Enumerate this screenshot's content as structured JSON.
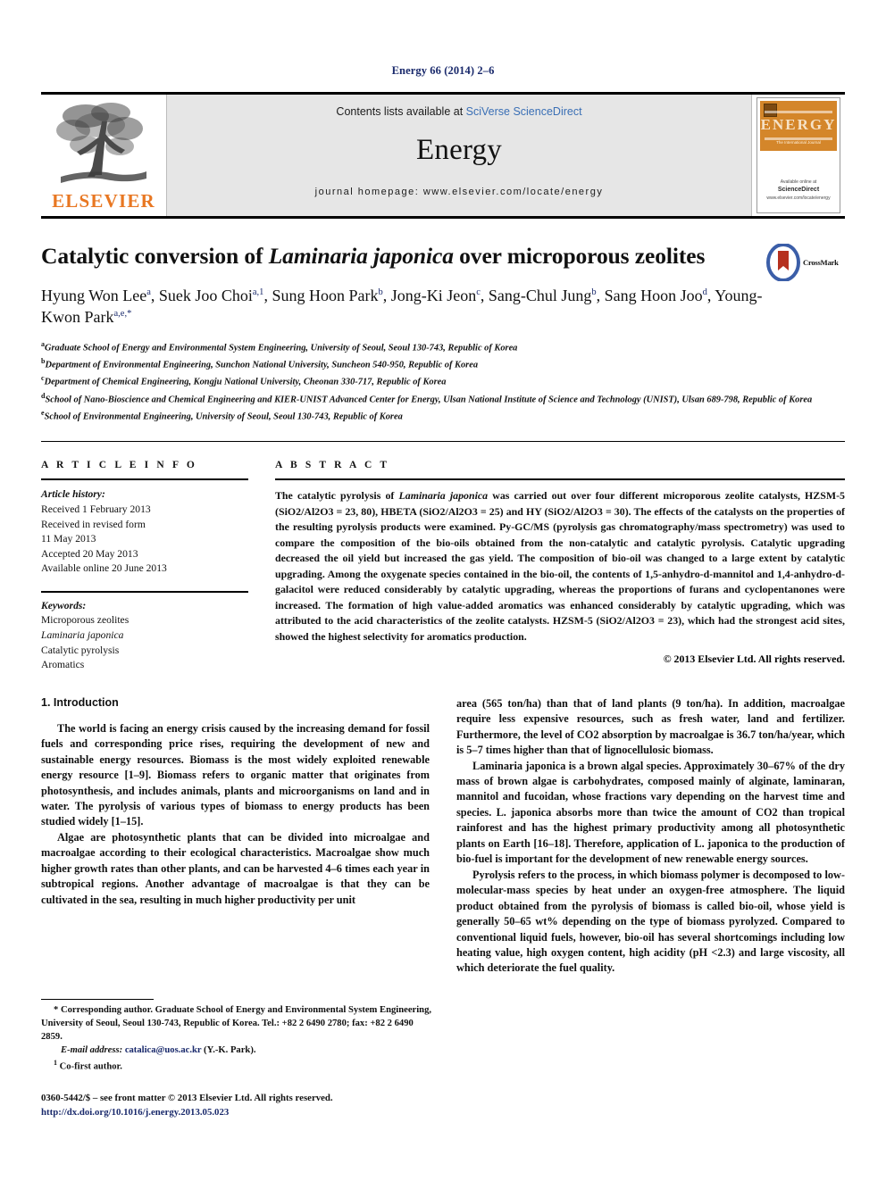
{
  "running_head": "Energy 66 (2014) 2–6",
  "masthead": {
    "publisher_wordmark": "ELSEVIER",
    "contents_prefix": "Contents lists available at ",
    "contents_link": "SciVerse ScienceDirect",
    "journal_name": "Energy",
    "homepage": "journal homepage: www.elsevier.com/locate/energy",
    "cover": {
      "banner_title": "ENERGY",
      "banner_subtitle": "The International Journal",
      "footer_line1": "Available online at",
      "footer_line2": "ScienceDirect",
      "footer_line3": "www.elsevier.com/locate/energy"
    }
  },
  "article": {
    "title_part1": "Catalytic conversion of ",
    "title_italic": "Laminaria japonica",
    "title_part2": " over microporous zeolites",
    "crossmark_label": "CrossMark",
    "authors_line1": "Hyung Won Lee a, Suek Joo Choi a,1, Sung Hoon Park b, Jong-Ki Jeon c, Sang-Chul Jung b,",
    "authors": [
      {
        "name": "Hyung Won Lee",
        "sup": "a"
      },
      {
        "name": "Suek Joo Choi",
        "sup": "a,1"
      },
      {
        "name": "Sung Hoon Park",
        "sup": "b"
      },
      {
        "name": "Jong-Ki Jeon",
        "sup": "c"
      },
      {
        "name": "Sang-Chul Jung",
        "sup": "b"
      },
      {
        "name": "Sang Hoon Joo",
        "sup": "d"
      },
      {
        "name": "Young-Kwon Park",
        "sup": "a,e,*"
      }
    ],
    "affiliations": [
      {
        "sup": "a",
        "text": "Graduate School of Energy and Environmental System Engineering, University of Seoul, Seoul 130-743, Republic of Korea"
      },
      {
        "sup": "b",
        "text": "Department of Environmental Engineering, Sunchon National University, Suncheon 540-950, Republic of Korea"
      },
      {
        "sup": "c",
        "text": "Department of Chemical Engineering, Kongju National University, Cheonan 330-717, Republic of Korea"
      },
      {
        "sup": "d",
        "text": "School of Nano-Bioscience and Chemical Engineering and KIER-UNIST Advanced Center for Energy, Ulsan National Institute of Science and Technology (UNIST), Ulsan 689-798, Republic of Korea"
      },
      {
        "sup": "e",
        "text": "School of Environmental Engineering, University of Seoul, Seoul 130-743, Republic of Korea"
      }
    ]
  },
  "article_info": {
    "heading": "A R T I C L E  I N F O",
    "history_label": "Article history:",
    "history": [
      "Received 1 February 2013",
      "Received in revised form",
      "11 May 2013",
      "Accepted 20 May 2013",
      "Available online 20 June 2013"
    ],
    "keywords_label": "Keywords:",
    "keywords": [
      "Microporous zeolites",
      "Laminaria japonica",
      "Catalytic pyrolysis",
      "Aromatics"
    ]
  },
  "abstract": {
    "heading": "A B S T R A C T",
    "text_a": "The catalytic pyrolysis of ",
    "text_italic": "Laminaria japonica",
    "text_b": " was carried out over four different microporous zeolite catalysts, HZSM-5 (SiO2/Al2O3 = 23, 80), HBETA (SiO2/Al2O3 = 25) and HY (SiO2/Al2O3 = 30). The effects of the catalysts on the properties of the resulting pyrolysis products were examined. Py-GC/MS (pyrolysis gas chromatography/mass spectrometry) was used to compare the composition of the bio-oils obtained from the non-catalytic and catalytic pyrolysis. Catalytic upgrading decreased the oil yield but increased the gas yield. The composition of bio-oil was changed to a large extent by catalytic upgrading. Among the oxygenate species contained in the bio-oil, the contents of 1,5-anhydro-d-mannitol and 1,4-anhydro-d-galacitol were reduced considerably by catalytic upgrading, whereas the proportions of furans and cyclopentanones were increased. The formation of high value-added aromatics was enhanced considerably by catalytic upgrading, which was attributed to the acid characteristics of the zeolite catalysts. HZSM-5 (SiO2/Al2O3 = 23), which had the strongest acid sites, showed the highest selectivity for aromatics production.",
    "copyright": "© 2013 Elsevier Ltd. All rights reserved."
  },
  "body": {
    "section_number_title": "1. Introduction",
    "left_paragraphs": [
      "The world is facing an energy crisis caused by the increasing demand for fossil fuels and corresponding price rises, requiring the development of new and sustainable energy resources. Biomass is the most widely exploited renewable energy resource [1–9]. Biomass refers to organic matter that originates from photosynthesis, and includes animals, plants and microorganisms on land and in water. The pyrolysis of various types of biomass to energy products has been studied widely [1–15].",
      "Algae are photosynthetic plants that can be divided into microalgae and macroalgae according to their ecological characteristics. Macroalgae show much higher growth rates than other plants, and can be harvested 4–6 times each year in subtropical regions. Another advantage of macroalgae is that they can be cultivated in the sea, resulting in much higher productivity per unit"
    ],
    "right_paragraphs": [
      "area (565 ton/ha) than that of land plants (9 ton/ha). In addition, macroalgae require less expensive resources, such as fresh water, land and fertilizer. Furthermore, the level of CO2 absorption by macroalgae is 36.7 ton/ha/year, which is 5–7 times higher than that of lignocellulosic biomass.",
      "Laminaria japonica is a brown algal species. Approximately 30–67% of the dry mass of brown algae is carbohydrates, composed mainly of alginate, laminaran, mannitol and fucoidan, whose fractions vary depending on the harvest time and species. L. japonica absorbs more than twice the amount of CO2 than tropical rainforest and has the highest primary productivity among all photosynthetic plants on Earth [16–18]. Therefore, application of L. japonica to the production of bio-fuel is important for the development of new renewable energy sources.",
      "Pyrolysis refers to the process, in which biomass polymer is decomposed to low-molecular-mass species by heat under an oxygen-free atmosphere. The liquid product obtained from the pyrolysis of biomass is called bio-oil, whose yield is generally 50–65 wt% depending on the type of biomass pyrolyzed. Compared to conventional liquid fuels, however, bio-oil has several shortcomings including low heating value, high oxygen content, high acidity (pH <2.3) and large viscosity, all which deteriorate the fuel quality."
    ]
  },
  "footnotes": {
    "corresponding": "* Corresponding author. Graduate School of Energy and Environmental System Engineering, University of Seoul, Seoul 130-743, Republic of Korea. Tel.: +82 2 6490 2780; fax: +82 2 6490 2859.",
    "email_label": "E-mail address:",
    "email": "catalica@uos.ac.kr",
    "email_suffix": " (Y.-K. Park).",
    "cofirst_sup": "1",
    "cofirst": "Co-first author."
  },
  "imprint": {
    "line1": "0360-5442/$ – see front matter © 2013 Elsevier Ltd. All rights reserved.",
    "doi": "http://dx.doi.org/10.1016/j.energy.2013.05.023"
  },
  "colors": {
    "link_blue": "#3a6fb5",
    "ref_navy": "#1a2a6c",
    "elsevier_orange": "#E87722",
    "cover_orange": "#d4862a",
    "masthead_gray": "#e6e6e6"
  }
}
